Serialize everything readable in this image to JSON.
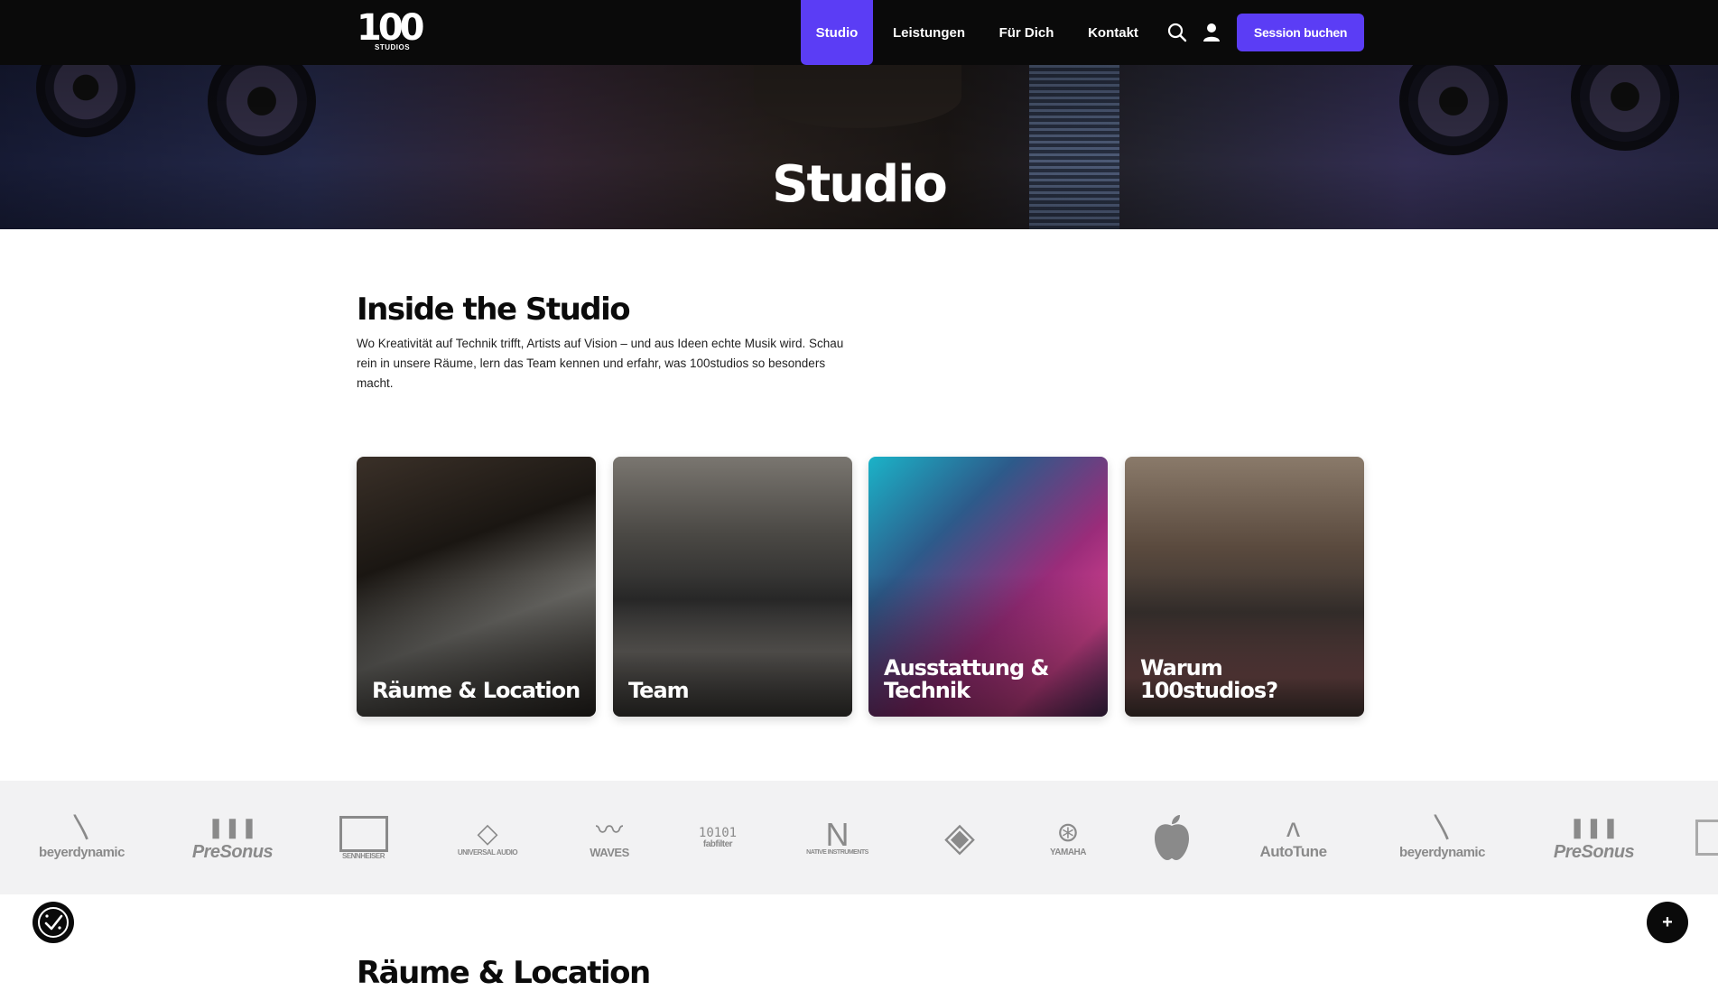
{
  "header": {
    "logo_number": "100",
    "logo_sub": "STUDIOS",
    "nav": [
      {
        "label": "Studio",
        "active": true
      },
      {
        "label": "Leistungen",
        "active": false
      },
      {
        "label": "Für Dich",
        "active": false
      },
      {
        "label": "Kontakt",
        "active": false
      }
    ],
    "search_icon": "search-icon",
    "account_icon": "user-icon",
    "cta_label": "Session buchen",
    "accent_color": "#5b3df5"
  },
  "hero": {
    "title": "Studio"
  },
  "intro": {
    "title": "Inside the Studio",
    "text": "Wo Kreativität auf Technik trifft, Artists auf Vision – und aus Ideen echte Musik wird. Schau rein in unsere Räume, lern das Team kennen und erfahr, was 100studios so besonders macht."
  },
  "cards": [
    {
      "label": "Räume & Location"
    },
    {
      "label": "Team"
    },
    {
      "label": "Ausstattung & Technik"
    },
    {
      "label": "Warum 100studios?"
    }
  ],
  "brands": [
    {
      "name": "beyerdynamic"
    },
    {
      "name": "PreSonus"
    },
    {
      "name": "SENNHEISER"
    },
    {
      "name": "UNIVERSAL AUDIO"
    },
    {
      "name": "WAVES"
    },
    {
      "name": "fabfilter"
    },
    {
      "name": "NATIVE INSTRUMENTS"
    },
    {
      "name": ""
    },
    {
      "name": "YAMAHA"
    },
    {
      "name": ""
    },
    {
      "name": "AutoTune"
    },
    {
      "name": "beyerdynamic"
    },
    {
      "name": "PreSonus"
    }
  ],
  "next_section": {
    "title": "Räume & Location"
  },
  "fab_right_label": "+"
}
